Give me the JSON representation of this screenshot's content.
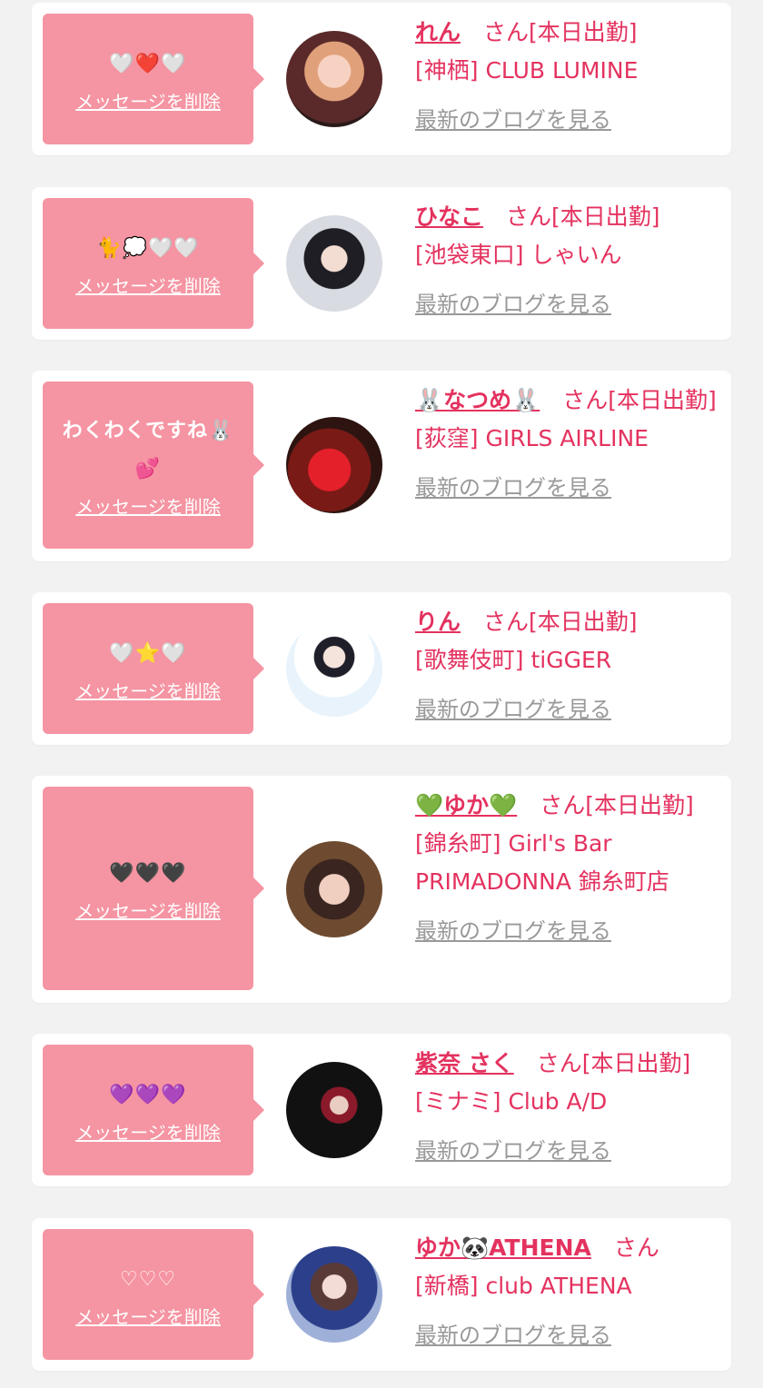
{
  "cards": [
    {
      "message": "🤍❤️🤍",
      "delete": "メッセージを削除",
      "name": "れん",
      "suffix": "さん[本日出勤]",
      "shop": "[神栖] CLUB LUMINE",
      "blog": "最新のブログを見る"
    },
    {
      "message": "🐈💭🤍🤍",
      "delete": "メッセージを削除",
      "name": "ひなこ",
      "suffix": "さん[本日出勤]",
      "shop": "[池袋東口] しゃいん",
      "blog": "最新のブログを見る"
    },
    {
      "message": "わくわくですね🐰\n💕",
      "delete": "メッセージを削除",
      "name": "🐰なつめ🐰",
      "suffix": "さん[本日出勤]",
      "shop": "[荻窪] GIRLS AIRLINE",
      "blog": "最新のブログを見る"
    },
    {
      "message": "🤍⭐🤍",
      "delete": "メッセージを削除",
      "name": "りん",
      "suffix": "さん[本日出勤]",
      "shop": "[歌舞伎町] tiGGER",
      "blog": "最新のブログを見る"
    },
    {
      "message": "🖤🖤🖤",
      "delete": "メッセージを削除",
      "name": "💚ゆか💚",
      "suffix": "さん[本日出勤]",
      "shop": "[錦糸町] Girl's Bar PRIMADONNA 錦糸町店",
      "blog": "最新のブログを見る"
    },
    {
      "message": "💜💜💜",
      "delete": "メッセージを削除",
      "name": "紫奈 さく",
      "suffix": "さん[本日出勤]",
      "shop": "[ミナミ] Club A/D",
      "blog": "最新のブログを見る"
    },
    {
      "message": "♡♡♡",
      "delete": "メッセージを削除",
      "name": "ゆか🐼ATHENA",
      "suffix": "さん",
      "shop": "[新橋] club ATHENA",
      "blog": "最新のブログを見る"
    }
  ],
  "colors": {
    "bubble": "#f594a2",
    "accent": "#e4325f",
    "muted": "#999999",
    "background": "#f2f2f2"
  }
}
